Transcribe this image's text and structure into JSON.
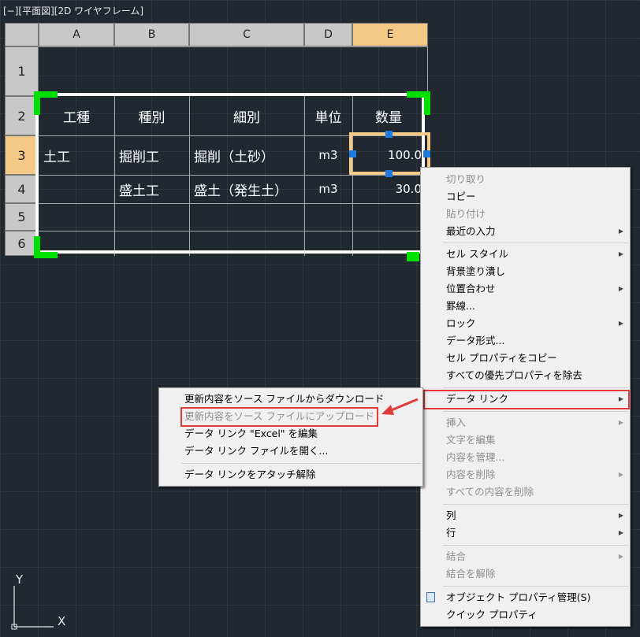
{
  "viewport_label": "[−][平面図][2D ワイヤフレーム]",
  "spreadsheet": {
    "columns": [
      "A",
      "B",
      "C",
      "D",
      "E"
    ],
    "rows": [
      "1",
      "2",
      "3",
      "4",
      "5",
      "6"
    ],
    "selected_column": "E",
    "selected_row": "3"
  },
  "table": {
    "headers": [
      "工種",
      "種別",
      "細別",
      "単位",
      "数量"
    ],
    "rows": [
      [
        "土工",
        "掘削工",
        "掘削（土砂）",
        "m3",
        "100.0"
      ],
      [
        "",
        "盛土工",
        "盛土（発生土）",
        "m3",
        "30.0"
      ]
    ]
  },
  "context_menu": {
    "items": [
      {
        "label": "切り取り",
        "disabled": true
      },
      {
        "label": "コピー"
      },
      {
        "label": "貼り付け",
        "disabled": true
      },
      {
        "label": "最近の入力",
        "submenu": true
      },
      {
        "label": "セル スタイル",
        "submenu": true
      },
      {
        "label": "背景塗り潰し"
      },
      {
        "label": "位置合わせ",
        "submenu": true
      },
      {
        "label": "罫線..."
      },
      {
        "label": "ロック",
        "submenu": true
      },
      {
        "label": "データ形式..."
      },
      {
        "label": "セル プロパティをコピー"
      },
      {
        "label": "すべての優先プロパティを除去"
      },
      {
        "label": "データ リンク",
        "submenu": true,
        "highlighted": true
      },
      {
        "label": "挿入",
        "submenu": true,
        "disabled": true
      },
      {
        "label": "文字を編集",
        "disabled": true
      },
      {
        "label": "内容を管理...",
        "disabled": true
      },
      {
        "label": "内容を削除",
        "submenu": true,
        "disabled": true
      },
      {
        "label": "すべての内容を削除",
        "disabled": true
      },
      {
        "label": "列",
        "submenu": true
      },
      {
        "label": "行",
        "submenu": true
      },
      {
        "label": "結合",
        "submenu": true,
        "disabled": true
      },
      {
        "label": "結合を解除",
        "disabled": true
      },
      {
        "label": "オブジェクト プロパティ管理(S)",
        "icon": "properties-icon"
      },
      {
        "label": "クイック プロパティ"
      }
    ]
  },
  "data_link_submenu": {
    "items": [
      {
        "label": "更新内容をソース ファイルからダウンロード"
      },
      {
        "label": "更新内容をソース ファイルにアップロード",
        "disabled": true,
        "highlighted": true
      },
      {
        "label": "データ リンク \"Excel\" を編集"
      },
      {
        "label": "データ リンク ファイルを開く..."
      },
      {
        "label": "データ リンクをアタッチ解除"
      }
    ]
  },
  "ucs": {
    "y_label": "Y",
    "x_label": "X"
  },
  "colors": {
    "background": "#212830",
    "header_selected": "#f4c986",
    "grip_green": "#00e000",
    "grip_blue": "#1f7ae0",
    "annotation_red": "#e23b3b"
  }
}
